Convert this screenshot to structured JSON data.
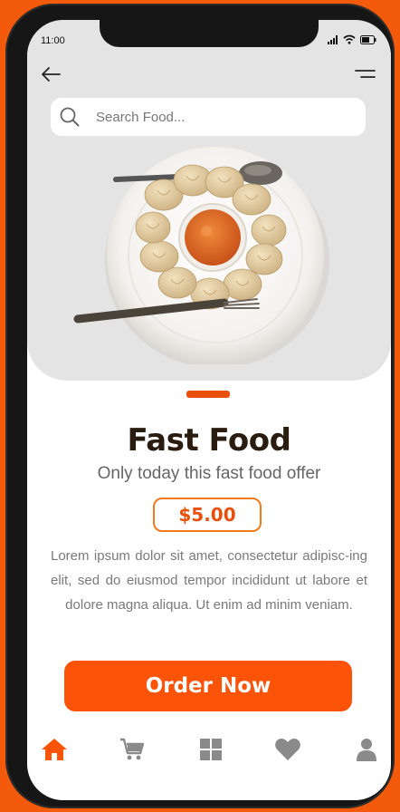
{
  "status_bar": {
    "time": "11:00"
  },
  "header": {
    "back_icon": "arrow-left-icon",
    "menu_icon": "menu-icon"
  },
  "search": {
    "placeholder": "Search Food..."
  },
  "product": {
    "title": "Fast Food",
    "subtitle": "Only today this fast food offer",
    "price": "$5.00",
    "description": "Lorem ipsum dolor sit amet, consectetur adipisc-ing elit, sed do eiusmod tempor incididunt ut labore et dolore magna aliqua. Ut enim ad minim veniam."
  },
  "order_button": {
    "label": "Order Now"
  },
  "bottom_nav": {
    "items": [
      {
        "icon": "home-icon",
        "active": true
      },
      {
        "icon": "cart-icon",
        "active": false
      },
      {
        "icon": "grid-icon",
        "active": false
      },
      {
        "icon": "heart-icon",
        "active": false
      },
      {
        "icon": "user-icon",
        "active": false
      }
    ]
  },
  "colors": {
    "accent": "#fb5408",
    "background": "#f45a0c",
    "title": "#2a1d10",
    "inactive_icon": "#8a8a8a"
  }
}
